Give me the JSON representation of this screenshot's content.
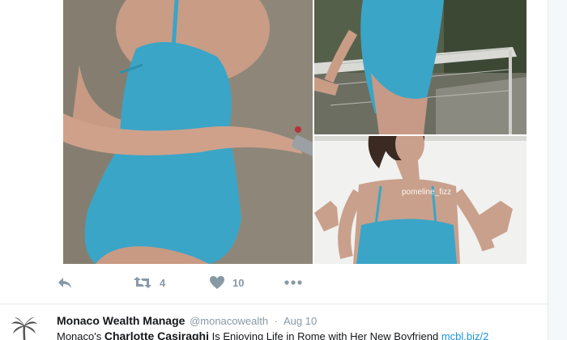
{
  "tweet": {
    "media": {
      "watermark": "pomeline_fizz"
    },
    "actions": {
      "reply_icon": "reply-icon",
      "retweet_icon": "retweet-icon",
      "retweet_count": "4",
      "like_icon": "heart-icon",
      "like_count": "10",
      "more_icon": "more-icon"
    }
  },
  "next_tweet": {
    "display_name": "Monaco Wealth Manage",
    "handle": "@monacowealth",
    "separator": "·",
    "date": "Aug 10",
    "text_prefix": "Monaco's ",
    "text_bold": "Charlotte Casiraghi",
    "text_body": " Is Enjoying Life in Rome with Her New Boyfriend ",
    "text_link": "mcbl.biz/2"
  },
  "colors": {
    "accent": "#1b95e0",
    "muted": "#8899a6",
    "text": "#14171a",
    "swimsuit": "#3aa5c7"
  }
}
